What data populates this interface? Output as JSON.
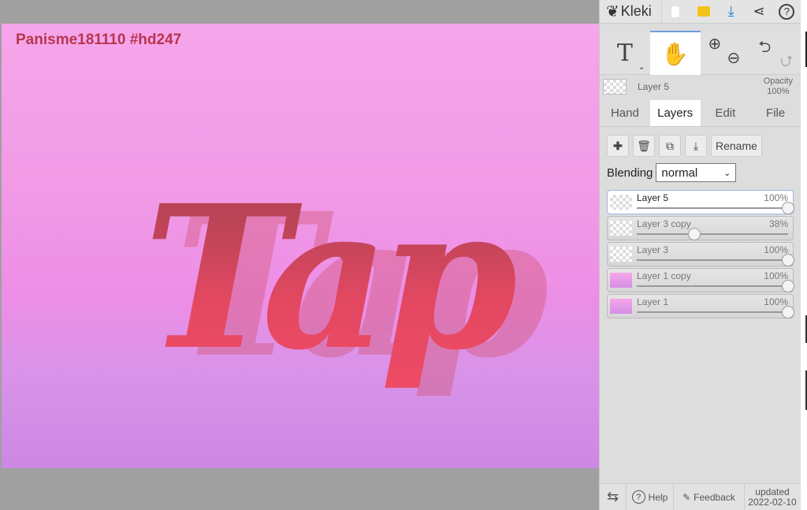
{
  "canvas": {
    "title": "Panisme181110 #hd247",
    "artwork_text": "Tap"
  },
  "app": {
    "name": "Kleki"
  },
  "toolbar": {
    "icons": [
      "new-image-icon",
      "open-folder-icon",
      "download-icon",
      "share-icon",
      "help-icon"
    ],
    "help": "?"
  },
  "tools": {
    "text": "T",
    "hand": "hand-icon"
  },
  "current_layer": {
    "name": "Layer 5",
    "opacity_label": "Opacity",
    "opacity": "100%"
  },
  "tabs": [
    {
      "label": "Hand"
    },
    {
      "label": "Layers"
    },
    {
      "label": "Edit"
    },
    {
      "label": "File"
    }
  ],
  "layer_actions": {
    "rename": "Rename"
  },
  "blending": {
    "label": "Blending",
    "value": "normal"
  },
  "layers": [
    {
      "name": "Layer 5",
      "opacity": "100%",
      "value": 100
    },
    {
      "name": "Layer 3 copy",
      "opacity": "38%",
      "value": 38
    },
    {
      "name": "Layer 3",
      "opacity": "100%",
      "value": 100
    },
    {
      "name": "Layer 1 copy",
      "opacity": "100%",
      "value": 100
    },
    {
      "name": "Layer 1",
      "opacity": "100%",
      "value": 100
    }
  ],
  "footer": {
    "help": "Help",
    "feedback": "Feedback",
    "updated_label": "updated",
    "updated_date": "2022-02-10"
  }
}
